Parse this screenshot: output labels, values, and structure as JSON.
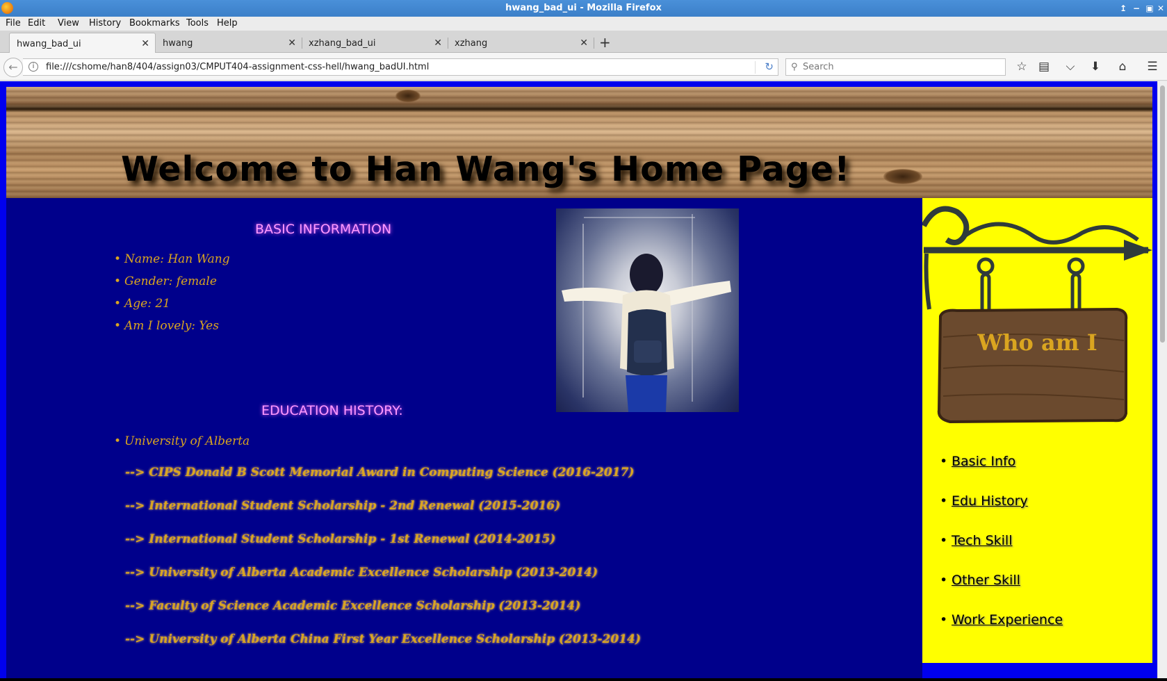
{
  "window": {
    "title": "hwang_bad_ui - Mozilla Firefox"
  },
  "menu": [
    "File",
    "Edit",
    "View",
    "History",
    "Bookmarks",
    "Tools",
    "Help"
  ],
  "tabs": [
    {
      "label": "hwang_bad_ui",
      "active": true
    },
    {
      "label": "hwang",
      "active": false
    },
    {
      "label": "xzhang_bad_ui",
      "active": false
    },
    {
      "label": "xzhang",
      "active": false
    }
  ],
  "navbar": {
    "url": "file:///cshome/han8/404/assign03/CMPUT404-assignment-css-hell/hwang_badUI.html",
    "search_placeholder": "Search"
  },
  "page": {
    "heading": "Welcome to Han Wang's Home Page!",
    "basic_title": "BASIC INFORMATION",
    "basic_info": [
      "Name: Han Wang",
      "Gender: female",
      "Age: 21",
      "Am I lovely: Yes"
    ],
    "education_title": "EDUCATION HISTORY:",
    "education": [
      "University of Alberta"
    ],
    "awards": [
      "--> CIPS Donald B Scott Memorial Award in Computing Science (2016-2017)",
      "--> International Student Scholarship - 2nd Renewal (2015-2016)",
      "--> International Student Scholarship - 1st Renewal (2014-2015)",
      "--> University of Alberta Academic Excellence Scholarship (2013-2014)",
      "--> Faculty of Science Academic Excellence Scholarship (2013-2014)",
      "--> University of Alberta China First Year Excellence Scholarship (2013-2014)"
    ],
    "sidebar_title": "Who am I",
    "sidebar_links": [
      "Basic Info",
      "Edu History",
      "Tech Skill",
      "Other Skill",
      "Work Experience"
    ]
  },
  "colors": {
    "page_bg": "#0000ee",
    "main_bg": "#00008b",
    "sidebar_bg": "#ffff00",
    "text_gold": "#daa520",
    "section_pink": "#ff99ff"
  },
  "icons": [
    "firefox-logo",
    "back-icon",
    "info-icon",
    "reload-icon",
    "search-icon",
    "bookmark-star-icon",
    "reading-list-icon",
    "pocket-icon",
    "download-icon",
    "home-icon",
    "menu-icon"
  ]
}
